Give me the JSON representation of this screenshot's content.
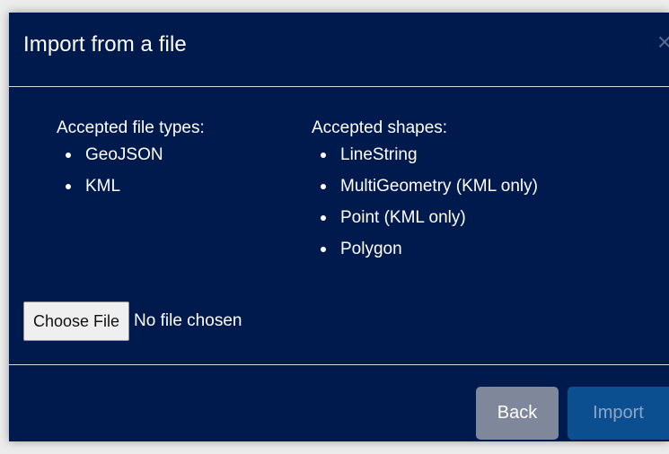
{
  "modal": {
    "title": "Import from a file",
    "close_label": "×"
  },
  "content": {
    "file_types_title": "Accepted file types:",
    "file_types": [
      "GeoJSON",
      "KML"
    ],
    "shapes_title": "Accepted shapes:",
    "shapes": [
      "LineString",
      "MultiGeometry (KML only)",
      "Point (KML only)",
      "Polygon"
    ]
  },
  "file_input": {
    "button_label": "Choose File",
    "status": "No file chosen"
  },
  "footer": {
    "back_label": "Back",
    "import_label": "Import"
  },
  "colors": {
    "modal_background": "#001a4d",
    "back_button": "#7f879a",
    "import_button": "#0c4f91",
    "divider": "#d5d9e2"
  }
}
